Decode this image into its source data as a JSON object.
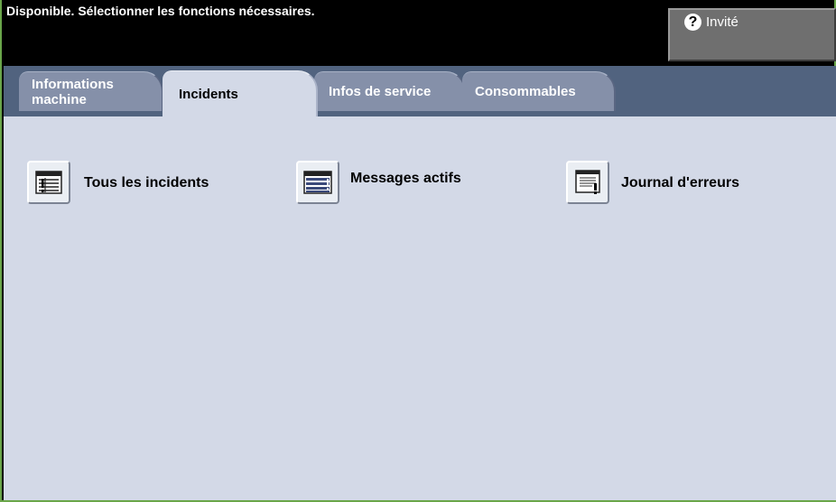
{
  "status": {
    "message": "Disponible.  Sélectionner les fonctions nécessaires."
  },
  "user": {
    "help_glyph": "?",
    "label": "Invité"
  },
  "tabs": [
    {
      "line1": "Informations",
      "line2": "machine"
    },
    {
      "label": "Incidents"
    },
    {
      "label": "Infos de service"
    },
    {
      "label": "Consommables"
    }
  ],
  "active_tab": "Incidents",
  "functions": [
    {
      "label": "Tous les incidents",
      "icon": "all-faults-icon"
    },
    {
      "label": "Messages actifs",
      "icon": "active-messages-icon"
    },
    {
      "label": "Journal d'erreurs",
      "icon": "error-log-icon"
    }
  ]
}
